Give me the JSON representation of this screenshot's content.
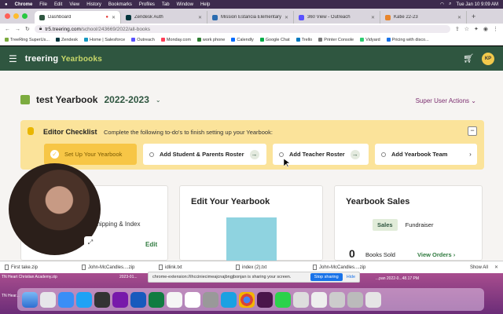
{
  "menubar": {
    "app": "Chrome",
    "items": [
      "File",
      "Edit",
      "View",
      "History",
      "Bookmarks",
      "Profiles",
      "Tab",
      "Window",
      "Help"
    ],
    "datetime": "Tue Jan 10  9:09 AM"
  },
  "tabs": [
    {
      "label": "Dashboard",
      "color": "#2f5640",
      "active": true
    },
    {
      "label": "Zendesk Auth",
      "color": "#03363d",
      "active": false
    },
    {
      "label": "Mission Estancia Elementary S",
      "color": "#2b6cb0",
      "active": false
    },
    {
      "label": "360 View - Outreach",
      "color": "#5951ff",
      "active": false
    },
    {
      "label": "Katie 22-23",
      "color": "#e8852b",
      "active": false
    }
  ],
  "address": {
    "host": "tr5.treering.com",
    "path": "/school/243669/2022/all-books"
  },
  "bookmarks": [
    "TreeRing SuperUs...",
    "Zendesk",
    "Home | Salesforce",
    "Outreach",
    "Monday.com",
    "work phone",
    "Calendly",
    "Google Chat",
    "Trello",
    "Printer Console",
    "Vidyard",
    "Pricing with disco..."
  ],
  "app": {
    "brand": "treering",
    "brand_sub": "Yearbooks",
    "avatar": "KP"
  },
  "page": {
    "book_name": "test Yearbook",
    "year": "2022-2023",
    "super_user": "Super User Actions"
  },
  "checklist": {
    "title": "Editor Checklist",
    "subtitle": "Complete the following to-do's to finish setting up your Yearbook:",
    "steps": [
      {
        "label": "Set Up Your Yearbook",
        "done": true
      },
      {
        "label": "Add Student & Parents Roster",
        "done": false
      },
      {
        "label": "Add Teacher Roster",
        "done": false
      },
      {
        "label": "Add Yearbook Team",
        "done": false
      }
    ]
  },
  "cards": {
    "shipping": {
      "text": "Shipping & Index",
      "edit": "Edit"
    },
    "edit": {
      "title": "Edit Your Yearbook"
    },
    "sales": {
      "title": "Yearbook Sales",
      "tab_sales": "Sales",
      "tab_fundraiser": "Fundraiser",
      "books_sold_count": "0",
      "books_sold_label": "Books Sold",
      "view_orders": "View Orders"
    }
  },
  "downloads": {
    "items": [
      "First take.zip",
      "John-McCandles....zip",
      "idlink.txt",
      "index (2).txt",
      "John-McCandles....zip"
    ],
    "show_all": "Show All"
  },
  "sharing": {
    "text": "chrome-extension://ihcciniecimeajcnajbngjbonjan is sharing your screen.",
    "stop": "Stop sharing",
    "hide": "Hide"
  },
  "desktop": {
    "labels": [
      "TN Heart Christian Academy.zip",
      "2023-01...",
      "2023-01-09 at 1...59 PM",
      "...pan 2022-0...48.17 PM",
      "TN Hear..."
    ]
  }
}
